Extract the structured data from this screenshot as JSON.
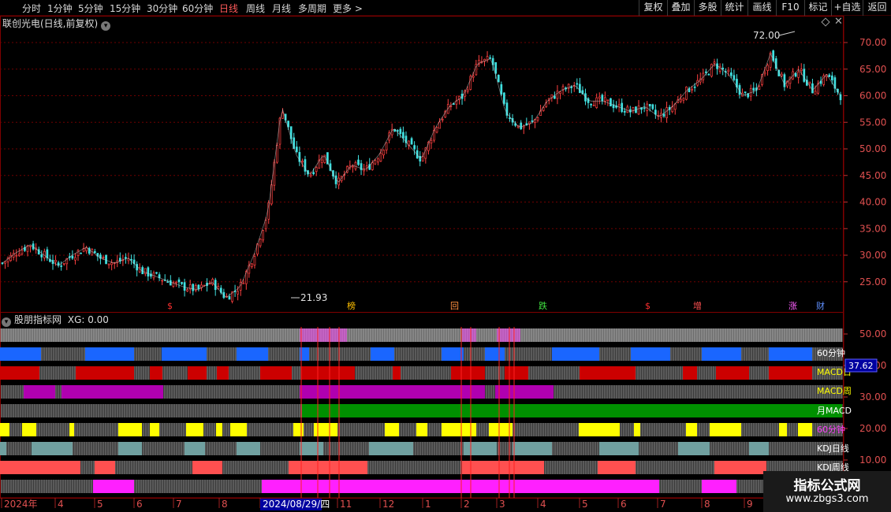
{
  "toolbar": {
    "periods": [
      "分时",
      "1分钟",
      "5分钟",
      "15分钟",
      "30分钟",
      "60分钟",
      "日线",
      "周线",
      "月线",
      "多周期",
      "更多 >"
    ],
    "active_period": "日线",
    "tools": [
      "复权",
      "叠加",
      "多股",
      "统计",
      "画线",
      "F10",
      "标记",
      "+自选",
      "返回"
    ]
  },
  "main_chart": {
    "title": "联创光电(日线,前复权)",
    "high_label": "72.00",
    "low_label": "21.93",
    "signals": [
      {
        "text": "$",
        "color": "#ff3030"
      },
      {
        "text": "榜",
        "color": "#ffc000"
      },
      {
        "text": "回",
        "color": "#ff9040"
      },
      {
        "text": "跌",
        "color": "#40e040"
      },
      {
        "text": "$",
        "color": "#ff3030"
      },
      {
        "text": "增",
        "color": "#ff5050"
      },
      {
        "text": "涨",
        "color": "#ff60ff"
      },
      {
        "text": "财",
        "color": "#6090ff"
      }
    ]
  },
  "sub_chart": {
    "title": "股朋指标网",
    "xg_label": "XG: 0.00",
    "rows": [
      {
        "label": "",
        "color": "#c8c8c8"
      },
      {
        "label": "60分钟",
        "color": "#1a66ff"
      },
      {
        "label": "MACD日",
        "color": "#cc0000"
      },
      {
        "label": "MACD周",
        "color": "#b000b0"
      },
      {
        "label": "月MACD",
        "color": "#009000"
      },
      {
        "label": "60分钟",
        "color": "#ffff00"
      },
      {
        "label": "KDJ日线",
        "color": "#70a0a0"
      },
      {
        "label": "KDJ周线",
        "color": "#ff5050"
      },
      {
        "label": "",
        "color": "#ff20ff"
      }
    ],
    "current_value": "37.62"
  },
  "chart_data": {
    "type": "candlestick",
    "main_axis": {
      "ticks": [
        "70.00",
        "65.00",
        "60.00",
        "55.00",
        "50.00",
        "45.00",
        "40.00",
        "35.00",
        "30.00",
        "25.00"
      ]
    },
    "sub_axis": {
      "ticks": [
        "50.00",
        "40.00",
        "30.00",
        "20.00",
        "10.00"
      ]
    },
    "x_labels": [
      "2024年",
      "4",
      "5",
      "6",
      "7",
      "8",
      "2024/08/29/四",
      "11",
      "12",
      "1",
      "2",
      "3",
      "4",
      "5",
      "6",
      "7",
      "8",
      "9"
    ],
    "closes": [
      28.5,
      30.5,
      32,
      30,
      28,
      30,
      31.5,
      29.5,
      28.5,
      29.5,
      27,
      26,
      25,
      24,
      23.5,
      25,
      22,
      24,
      30,
      38,
      58,
      49,
      45,
      49,
      43.5,
      47,
      46,
      49,
      54,
      51,
      48,
      54,
      58,
      60,
      66,
      67,
      57,
      54,
      55,
      59,
      61,
      62,
      59,
      59,
      58,
      57,
      58,
      56,
      58,
      61,
      63,
      66,
      64,
      60,
      61,
      68,
      62,
      65,
      61,
      64,
      60
    ]
  },
  "watermark": {
    "title": "指标公式网",
    "url": "www.zbgs3.com"
  }
}
